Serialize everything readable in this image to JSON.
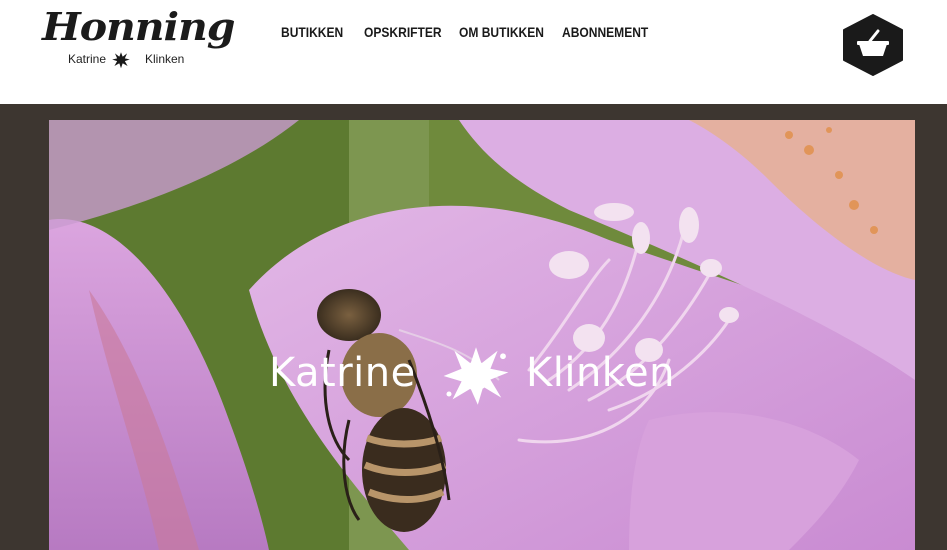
{
  "logo": {
    "title": "Honning",
    "sub_left": "Katrine",
    "sub_right": "Klinken"
  },
  "nav": [
    {
      "label": "BUTIKKEN"
    },
    {
      "label": "OPSKRIFTER"
    },
    {
      "label": "OM BUTIKKEN"
    },
    {
      "label": "ABONNEMENT"
    }
  ],
  "cart": {
    "icon": "basket-icon"
  },
  "hero": {
    "brand_left": "Katrine",
    "brand_right": "Klinken"
  },
  "colors": {
    "header_bg": "#ffffff",
    "page_bg": "#3d3630",
    "cart_bg": "#1a1a1a",
    "flower_pink": "#d9a2de",
    "foliage_green": "#6f8a3c"
  }
}
